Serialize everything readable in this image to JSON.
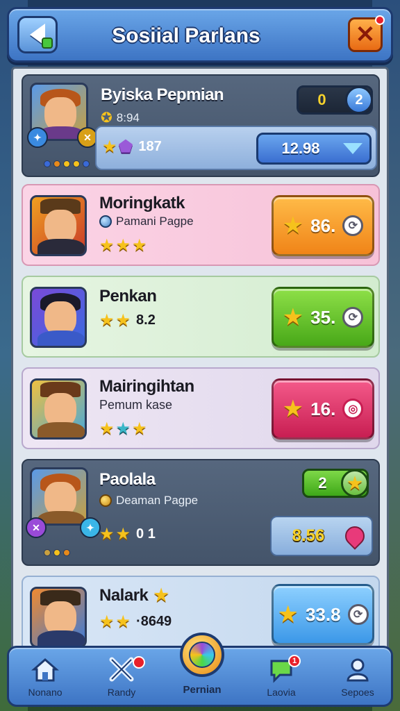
{
  "header": {
    "title": "Sosiial Parlans",
    "back_icon": "back-arrow-icon",
    "close_icon": "close-x-icon",
    "close_label": "✕"
  },
  "players": [
    {
      "name": "Byiska Pepmian",
      "sub": "8:94",
      "stars_val": "187",
      "pill_left_value": "0",
      "pill_left_icon": "2",
      "bottom_value": "12.98",
      "theme": "dark"
    },
    {
      "name": "Moringkatk",
      "sub": "Pamani Pagpe",
      "score": "86.",
      "theme": "pink",
      "button_color": "orange"
    },
    {
      "name": "Penkan",
      "stars_val": "8.2",
      "score": "35.",
      "theme": "green",
      "button_color": "green"
    },
    {
      "name": "Mairingihtan",
      "sub": "Pemum kase",
      "score": "16.",
      "theme": "lilac",
      "button_color": "red"
    },
    {
      "name": "Paolala",
      "sub": "Deaman Pagpe",
      "stars_val": "0 1",
      "pill_value": "2",
      "bottom_value": "8.56",
      "theme": "dark"
    },
    {
      "name": "Nalark",
      "stars_val": "·8649",
      "score": "33.8",
      "theme": "blue",
      "button_color": "sky"
    }
  ],
  "nav": {
    "items": [
      {
        "label": "Nonano",
        "icon": "home-icon"
      },
      {
        "label": "Randy",
        "icon": "crossed-swords-icon"
      },
      {
        "label": "Pernian",
        "icon": "crystal-orb-icon"
      },
      {
        "label": "Laovia",
        "icon": "chat-bubble-icon"
      },
      {
        "label": "Sepoes",
        "icon": "profile-icon"
      }
    ],
    "badge_count": "1"
  },
  "colors": {
    "header_blue": "#3d74c4",
    "orange_button": "#f08418",
    "green_button": "#48a818",
    "red_button": "#c81e52",
    "sky_button": "#3c98e8",
    "star_gold": "#f6c21c"
  }
}
